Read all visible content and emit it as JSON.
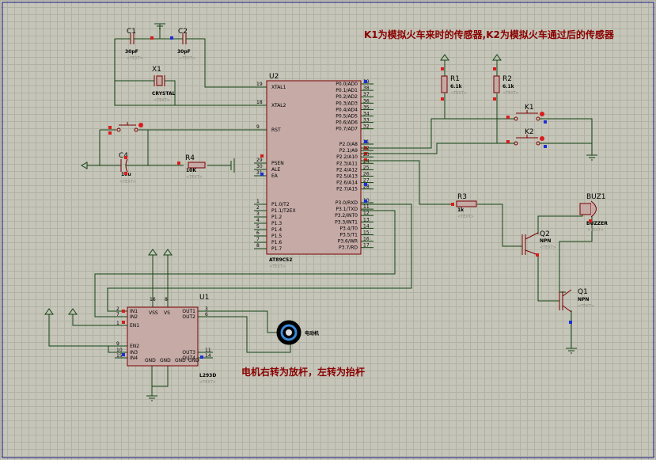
{
  "annotations": {
    "top": "K1为模拟火车来时的传感器,K2为模拟火车通过后的传感器",
    "bottom": "电机右转为放杆，左转为抬杆"
  },
  "text_placeholder": "<TEXT>",
  "mcu": {
    "ref": "U2",
    "part": "AT89C52",
    "left_pins": [
      {
        "num": "19",
        "name": "XTAL1"
      },
      {
        "num": "18",
        "name": "XTAL2"
      },
      {
        "num": "9",
        "name": "RST"
      },
      {
        "num": "29",
        "name": "PSEN"
      },
      {
        "num": "30",
        "name": "ALE"
      },
      {
        "num": "31",
        "name": "EA"
      },
      {
        "num": "1",
        "name": "P1.0/T2"
      },
      {
        "num": "2",
        "name": "P1.1/T2EX"
      },
      {
        "num": "3",
        "name": "P1.2"
      },
      {
        "num": "4",
        "name": "P1.3"
      },
      {
        "num": "5",
        "name": "P1.4"
      },
      {
        "num": "6",
        "name": "P1.5"
      },
      {
        "num": "7",
        "name": "P1.6"
      },
      {
        "num": "8",
        "name": "P1.7"
      }
    ],
    "right_pins": [
      {
        "num": "39",
        "name": "P0.0/AD0"
      },
      {
        "num": "38",
        "name": "P0.1/AD1"
      },
      {
        "num": "37",
        "name": "P0.2/AD2"
      },
      {
        "num": "36",
        "name": "P0.3/AD3"
      },
      {
        "num": "35",
        "name": "P0.4/AD4"
      },
      {
        "num": "34",
        "name": "P0.5/AD5"
      },
      {
        "num": "33",
        "name": "P0.6/AD6"
      },
      {
        "num": "32",
        "name": "P0.7/AD7"
      },
      {
        "num": "21",
        "name": "P2.0/A8"
      },
      {
        "num": "22",
        "name": "P2.1/A9"
      },
      {
        "num": "23",
        "name": "P2.2/A10"
      },
      {
        "num": "24",
        "name": "P2.3/A11"
      },
      {
        "num": "25",
        "name": "P2.4/A12"
      },
      {
        "num": "26",
        "name": "P2.5/A13"
      },
      {
        "num": "27",
        "name": "P2.6/A14"
      },
      {
        "num": "28",
        "name": "P2.7/A15"
      },
      {
        "num": "10",
        "name": "P3.0/RXD"
      },
      {
        "num": "11",
        "name": "P3.1/TXD"
      },
      {
        "num": "12",
        "name": "P3.2/INT0"
      },
      {
        "num": "13",
        "name": "P3.3/INT1"
      },
      {
        "num": "14",
        "name": "P3.4/T0"
      },
      {
        "num": "15",
        "name": "P3.5/T1"
      },
      {
        "num": "16",
        "name": "P3.6/WR"
      },
      {
        "num": "17",
        "name": "P3.7/RD"
      }
    ]
  },
  "driver": {
    "ref": "U1",
    "part": "L293D",
    "left_pins": [
      {
        "num": "2",
        "name": "IN1"
      },
      {
        "num": "7",
        "name": "IN2"
      },
      {
        "num": "1",
        "name": "EN1"
      },
      {
        "num": "9",
        "name": "EN2"
      },
      {
        "num": "10",
        "name": "IN3"
      },
      {
        "num": "15",
        "name": "IN4"
      }
    ],
    "top_pins": [
      {
        "num": "16",
        "name": "VSS"
      },
      {
        "num": "8",
        "name": "VS"
      }
    ],
    "right_pins": [
      {
        "num": "3",
        "name": "OUT1"
      },
      {
        "num": "6",
        "name": "OUT2"
      },
      {
        "num": "11",
        "name": "OUT3"
      },
      {
        "num": "14",
        "name": "OUT4"
      }
    ],
    "bottom_labels": [
      "GND",
      "GND",
      "GND",
      "GND"
    ]
  },
  "components": {
    "c1": {
      "ref": "C1",
      "value": "30pF"
    },
    "c2": {
      "ref": "C2",
      "value": "30pF"
    },
    "x1": {
      "ref": "X1",
      "value": "CRYSTAL"
    },
    "c4": {
      "ref": "C4",
      "value": "10u"
    },
    "r4": {
      "ref": "R4",
      "value": "10K"
    },
    "r1": {
      "ref": "R1",
      "value": "6.1k"
    },
    "r2": {
      "ref": "R2",
      "value": "6.1k"
    },
    "r3": {
      "ref": "R3",
      "value": "1k"
    },
    "k1": {
      "ref": "K1"
    },
    "k2": {
      "ref": "K2"
    },
    "buz": {
      "ref": "BUZ1",
      "value": "BUZZER"
    },
    "q1": {
      "ref": "Q1",
      "value": "NPN"
    },
    "q2": {
      "ref": "Q2",
      "value": "NPN"
    },
    "motor": {
      "label": "电动机"
    }
  }
}
